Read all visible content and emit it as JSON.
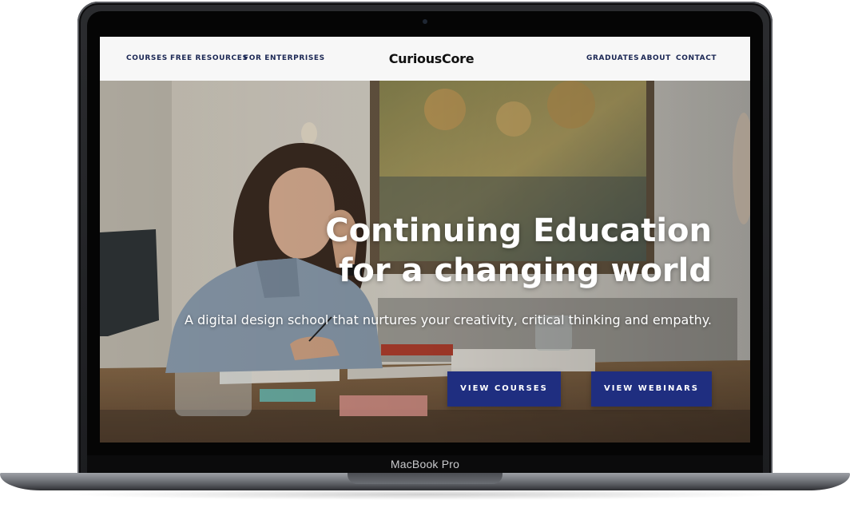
{
  "device": {
    "model_label": "MacBook Pro"
  },
  "site": {
    "brand": "CuriousCore",
    "nav_left": [
      {
        "label": "COURSES"
      },
      {
        "label": "FREE RESOURCES"
      },
      {
        "label": "FOR ENTERPRISES"
      }
    ],
    "nav_right": [
      {
        "label": "GRADUATES"
      },
      {
        "label": "ABOUT"
      },
      {
        "label": "CONTACT"
      }
    ]
  },
  "hero": {
    "title_line1": "Continuing Education",
    "title_line2": "for a changing world",
    "subtitle": "A digital design school that nurtures your creativity, critical thinking and empathy.",
    "buttons": {
      "primary": "VIEW COURSES",
      "secondary": "VIEW WEBINARS"
    }
  },
  "colors": {
    "brand_navy": "#1f2e80",
    "nav_text": "#1b2754",
    "header_bg": "#f7f7f7"
  }
}
